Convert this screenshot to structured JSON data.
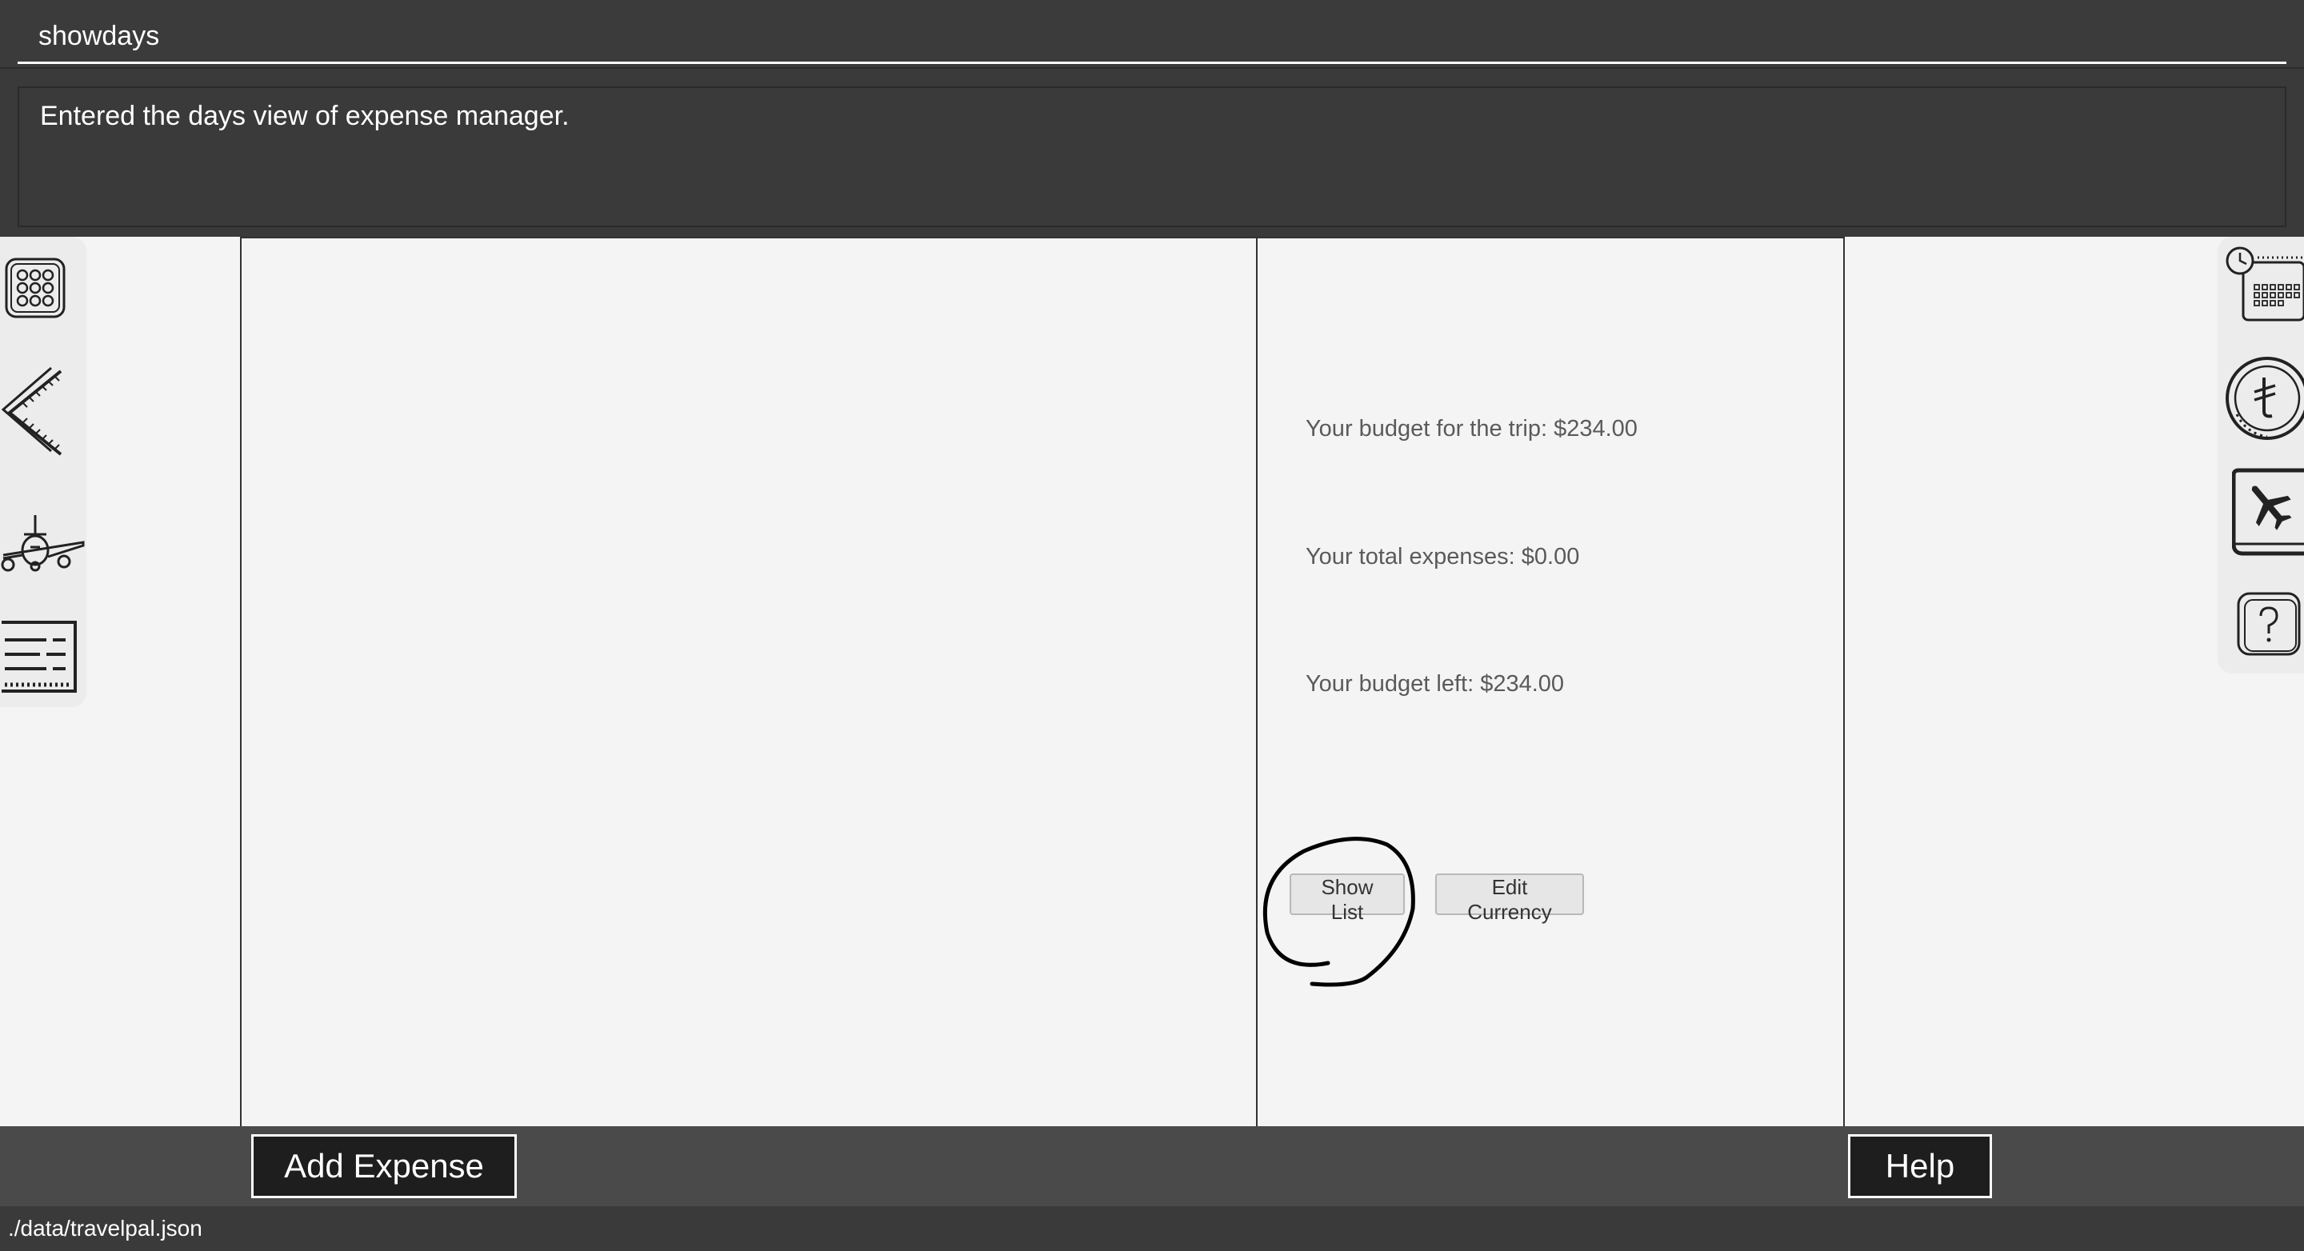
{
  "command": {
    "value": "showdays"
  },
  "result": {
    "message": "Entered the days view of expense manager."
  },
  "summary": {
    "budget": "Your budget for the trip: $234.00",
    "total": "Your total expenses: $0.00",
    "left": "Your budget left: $234.00"
  },
  "buttons": {
    "show_list": "Show List",
    "edit_currency": "Edit Currency",
    "add_expense": "Add Expense",
    "help": "Help"
  },
  "sidebar_left": {
    "icons": [
      "app-grid-icon",
      "back-arrow-icon",
      "airplane-icon",
      "ticket-list-icon"
    ]
  },
  "sidebar_right": {
    "icons": [
      "calendar-clock-icon",
      "currency-coin-icon",
      "travel-book-icon",
      "help-question-icon"
    ]
  },
  "status": {
    "path": "./data/travelpal.json"
  },
  "colors": {
    "dark": "#3a3a3a",
    "light": "#f4f4f4",
    "button_dark": "#1e1e1e"
  }
}
